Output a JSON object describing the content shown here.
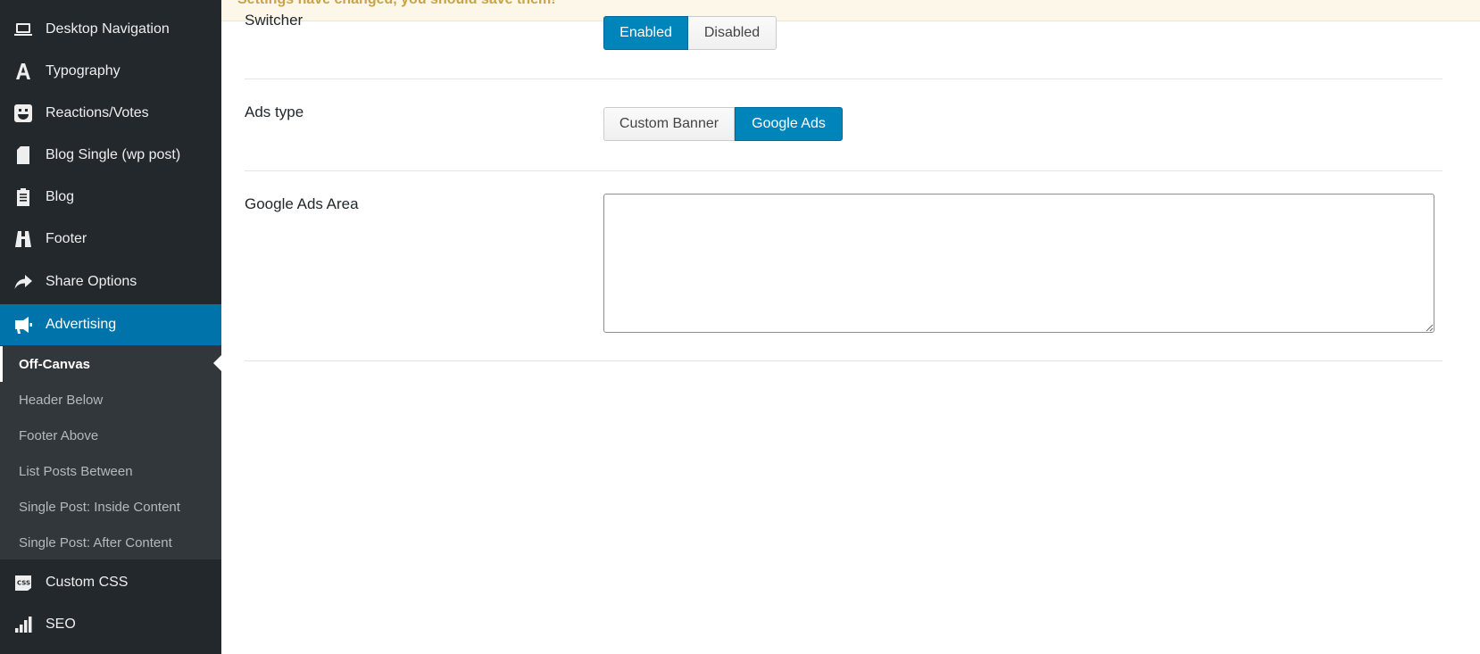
{
  "notice": {
    "text": "Settings have changed, you should save them!"
  },
  "sidebar": {
    "items": [
      {
        "label": "Desktop Navigation",
        "icon": "laptop-icon"
      },
      {
        "label": "Typography",
        "icon": "typography-icon"
      },
      {
        "label": "Reactions/Votes",
        "icon": "smiley-icon"
      },
      {
        "label": "Blog Single (wp post)",
        "icon": "document-icon"
      },
      {
        "label": "Blog",
        "icon": "clipboard-icon"
      },
      {
        "label": "Footer",
        "icon": "footer-icon"
      },
      {
        "label": "Share Options",
        "icon": "share-icon"
      },
      {
        "label": "Advertising",
        "icon": "megaphone-icon",
        "active": true
      },
      {
        "label": "Custom CSS",
        "icon": "css-icon"
      },
      {
        "label": "SEO",
        "icon": "chart-bars-icon"
      }
    ],
    "submenu": [
      {
        "label": "Off-Canvas",
        "current": true
      },
      {
        "label": "Header Below"
      },
      {
        "label": "Footer Above"
      },
      {
        "label": "List Posts Between"
      },
      {
        "label": "Single Post: Inside Content"
      },
      {
        "label": "Single Post: After Content"
      }
    ]
  },
  "main": {
    "switcher": {
      "label": "Switcher",
      "options": [
        "Enabled",
        "Disabled"
      ],
      "selected": "Enabled"
    },
    "ads_type": {
      "label": "Ads type",
      "options": [
        "Custom Banner",
        "Google Ads"
      ],
      "selected": "Google Ads"
    },
    "google_ads_area": {
      "label": "Google Ads Area",
      "value": ""
    }
  },
  "colors": {
    "sidebar_bg": "#23282d",
    "submenu_bg": "#32373c",
    "accent": "#0073aa",
    "button_active": "#0085ba",
    "notice_bg": "#fcf7e8",
    "notice_text": "#c9a24a"
  }
}
